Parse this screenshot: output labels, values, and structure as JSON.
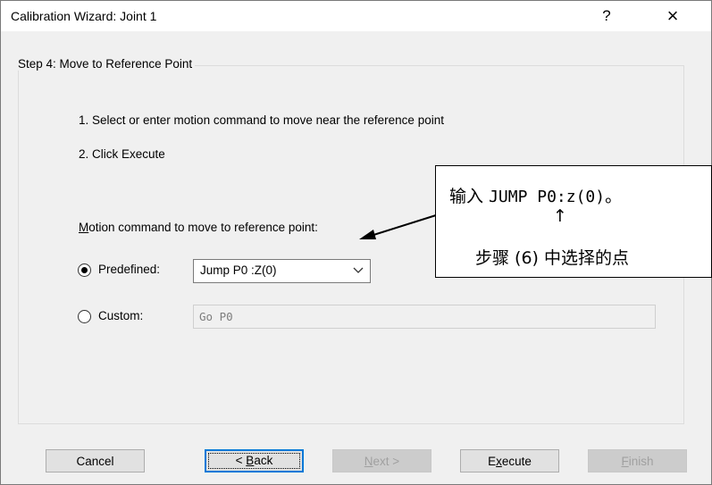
{
  "window": {
    "title": "Calibration Wizard: Joint 1",
    "help_label": "?",
    "close_label": "×"
  },
  "step": {
    "legend": "Step 4: Move to Reference Point",
    "instruction_1": "1. Select or enter motion command to move near the reference point",
    "instruction_2": "2. Click Execute",
    "motion_label_mnemonic": "M",
    "motion_label_rest": "otion command to move to reference point:"
  },
  "options": {
    "predefined_label": "Predefined:",
    "predefined_selected": true,
    "predefined_value": "Jump P0 :Z(0)",
    "custom_label": "Custom:",
    "custom_selected": false,
    "custom_value": "Go P0"
  },
  "buttons": {
    "cancel": "Cancel",
    "back_prefix": "< ",
    "back_mnemonic": "B",
    "back_rest": "ack",
    "next_mnemonic": "N",
    "next_rest": "ext >",
    "execute_prefix": "E",
    "execute_mnemonic": "x",
    "execute_rest": "ecute",
    "finish_mnemonic": "F",
    "finish_rest": "inish"
  },
  "callout": {
    "line1_prefix": "输入",
    "line1_code": "JUMP P0:z(0)",
    "line1_suffix": "。",
    "arrow": "↑",
    "line2": "步骤 (6) 中选择的点"
  },
  "icons": {
    "chevron": "chevron-down-icon",
    "pointer": "arrow-pointer"
  }
}
